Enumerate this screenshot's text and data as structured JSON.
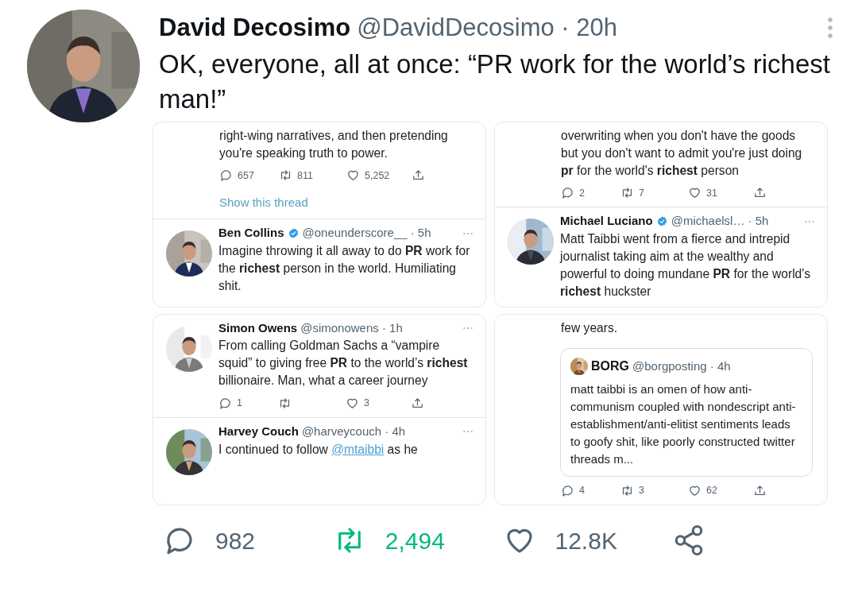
{
  "tweet": {
    "author": "David Decosimo",
    "meta": "@DavidDecosimo · 20h",
    "text": "OK, everyone, all at once: “PR work for the world’s richest man!”",
    "avatar": {
      "kind": "picture"
    }
  },
  "panels": [
    {
      "blocks": [
        {
          "kind": "continued",
          "text": "right-wing narratives, and then pretending you're speaking truth to power.",
          "stats": {
            "replies": "657",
            "retweets": "811",
            "likes": "5,252"
          },
          "link": "Show this thread"
        },
        {
          "kind": "tweet",
          "avatar": {
            "kind": "picture"
          },
          "name": "Ben Collins",
          "verified": true,
          "meta": "@oneunderscore__ · 5h",
          "text": "Imagine throwing it all away to do **PR** work for the **richest** person in the world. Humiliating shit."
        }
      ]
    },
    {
      "blocks": [
        {
          "kind": "continued",
          "text": "overwriting when you don't have the goods but you don't want to admit you're just doing **pr** for the world's **richest** person",
          "stats": {
            "replies": "2",
            "retweets": "7",
            "likes": "31"
          }
        },
        {
          "kind": "tweet",
          "avatar": {
            "kind": "picture"
          },
          "name": "Michael Luciano",
          "verified": true,
          "meta": "@michaelsl… · 5h",
          "text": "Matt Taibbi went from a fierce and intrepid journalist taking aim at the wealthy and powerful to doing mundane **PR** for the world's **richest** huckster"
        }
      ]
    },
    {
      "blocks": [
        {
          "kind": "tweet",
          "avatar": {
            "kind": "picture"
          },
          "name": "Simon Owens",
          "verified": false,
          "meta": "@simonowens · 1h",
          "text": "From calling Goldman Sachs a “vampire squid” to giving free **PR** to the world’s **richest** billionaire. Man, what a career journey",
          "stats": {
            "replies": "1",
            "likes": "3"
          }
        },
        {
          "kind": "tweet",
          "avatar": {
            "kind": "picture"
          },
          "name": "Harvey Couch",
          "verified": false,
          "meta": "@harveycouch · 4h",
          "segments": [
            {
              "kind": "plain",
              "text": "I continued to follow "
            },
            {
              "kind": "mention",
              "text": "@mtaibbi"
            },
            {
              "kind": "plain",
              "text": " as he"
            }
          ]
        }
      ]
    },
    {
      "blocks": [
        {
          "kind": "continued",
          "text": "few years.",
          "quote": {
            "avatar": {
              "kind": "picture"
            },
            "name": "BORG",
            "meta": "@borgposting · 4h",
            "text": "matt taibbi is an omen of how anti-communism coupled with nondescript anti-establishment/anti-elitist sentiments leads to goofy shit, like poorly constructed twitter threads m..."
          },
          "stats": {
            "replies": "4",
            "retweets": "3",
            "likes": "62"
          }
        }
      ]
    }
  ],
  "stats": {
    "replies": "982",
    "retweets": "2,494",
    "retweeted": true,
    "likes": "12.8K",
    "liked": false
  }
}
